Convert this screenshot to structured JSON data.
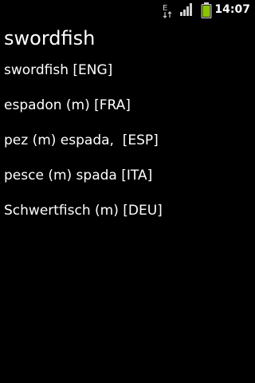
{
  "status_bar": {
    "time": "14:07",
    "data_icon_letter": "E",
    "colors": {
      "battery_fill": "#8ac400",
      "icon": "#cfcfcf"
    }
  },
  "header": {
    "title": "swordfish"
  },
  "translations": [
    {
      "text": "swordfish [ENG]"
    },
    {
      "text": "espadon (m) [FRA]"
    },
    {
      "text": "pez (m) espada,  [ESP]"
    },
    {
      "text": "pesce (m) spada [ITA]"
    },
    {
      "text": "Schwertfisch (m) [DEU]"
    }
  ]
}
